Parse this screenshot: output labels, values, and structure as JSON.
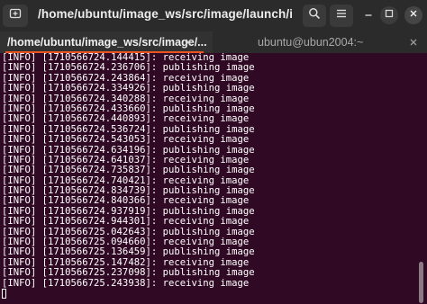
{
  "window": {
    "title": "/home/ubuntu/image_ws/src/image/launch/image.launch h..."
  },
  "header": {
    "new_tab_icon": "new-tab-icon",
    "search_icon": "search-icon",
    "menu_icon": "hamburger-menu-icon",
    "minimize_icon": "minimize-icon",
    "maximize_icon": "maximize-icon",
    "close_icon": "close-icon"
  },
  "tabs": [
    {
      "label": "/home/ubuntu/image_ws/src/image/...",
      "active": true
    },
    {
      "label": "ubuntu@ubun2004:~",
      "active": false
    }
  ],
  "colors": {
    "terminal_bg": "#300a24",
    "accent": "#e95420",
    "text": "#ffffff"
  },
  "terminal": {
    "lines": [
      "[INFO] [1710566724.144415]: receiving image",
      "[INFO] [1710566724.236706]: publishing image",
      "[INFO] [1710566724.243864]: receiving image",
      "[INFO] [1710566724.334926]: publishing image",
      "[INFO] [1710566724.340288]: receiving image",
      "[INFO] [1710566724.433660]: publishing image",
      "[INFO] [1710566724.440893]: receiving image",
      "[INFO] [1710566724.536724]: publishing image",
      "[INFO] [1710566724.543053]: receiving image",
      "[INFO] [1710566724.634196]: publishing image",
      "[INFO] [1710566724.641037]: receiving image",
      "[INFO] [1710566724.735837]: publishing image",
      "[INFO] [1710566724.740421]: receiving image",
      "[INFO] [1710566724.834739]: publishing image",
      "[INFO] [1710566724.840366]: receiving image",
      "[INFO] [1710566724.937919]: publishing image",
      "[INFO] [1710566724.944301]: receiving image",
      "[INFO] [1710566725.042643]: publishing image",
      "[INFO] [1710566725.094660]: receiving image",
      "[INFO] [1710566725.136459]: publishing image",
      "[INFO] [1710566725.147482]: receiving image",
      "[INFO] [1710566725.237098]: publishing image",
      "[INFO] [1710566725.243938]: receiving image"
    ]
  }
}
